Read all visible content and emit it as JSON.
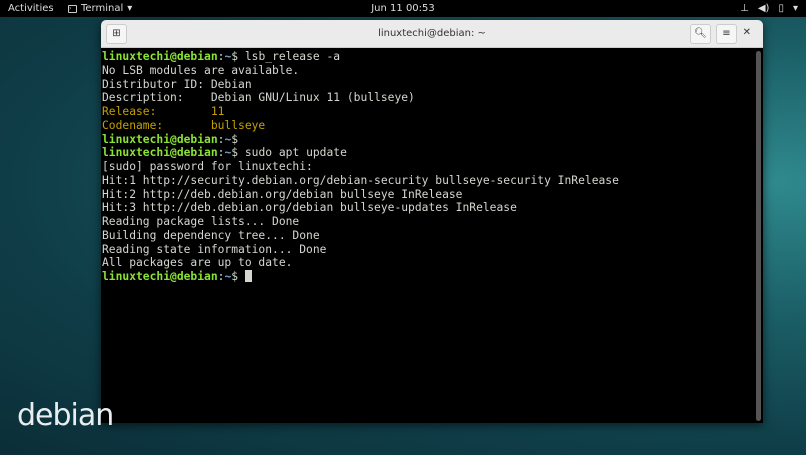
{
  "topbar": {
    "activities": "Activities",
    "app": "Terminal",
    "clock": "Jun 11  00:53",
    "icons": [
      "network-icon",
      "volume-icon",
      "battery-icon",
      "menu-arrow-icon"
    ]
  },
  "window": {
    "title": "linuxtechi@debian: ~"
  },
  "prompt": {
    "user": "linuxtechi@debian",
    "colon": ":",
    "path": "~",
    "sign": "$ "
  },
  "terminal": {
    "cmd1": "lsb_release -a",
    "out1": [
      "No LSB modules are available.",
      "Distributor ID: Debian",
      "Description:    Debian GNU/Linux 11 (bullseye)"
    ],
    "release": "Release:        11",
    "codename": "Codename:       bullseye",
    "cmd2": "",
    "cmd3": "sudo apt update",
    "out3": [
      "[sudo] password for linuxtechi:",
      "Hit:1 http://security.debian.org/debian-security bullseye-security InRelease",
      "Hit:2 http://deb.debian.org/debian bullseye InRelease",
      "Hit:3 http://deb.debian.org/debian bullseye-updates InRelease",
      "Reading package lists... Done",
      "Building dependency tree... Done",
      "Reading state information... Done",
      "All packages are up to date."
    ]
  },
  "desktop": {
    "logo": "debian"
  }
}
